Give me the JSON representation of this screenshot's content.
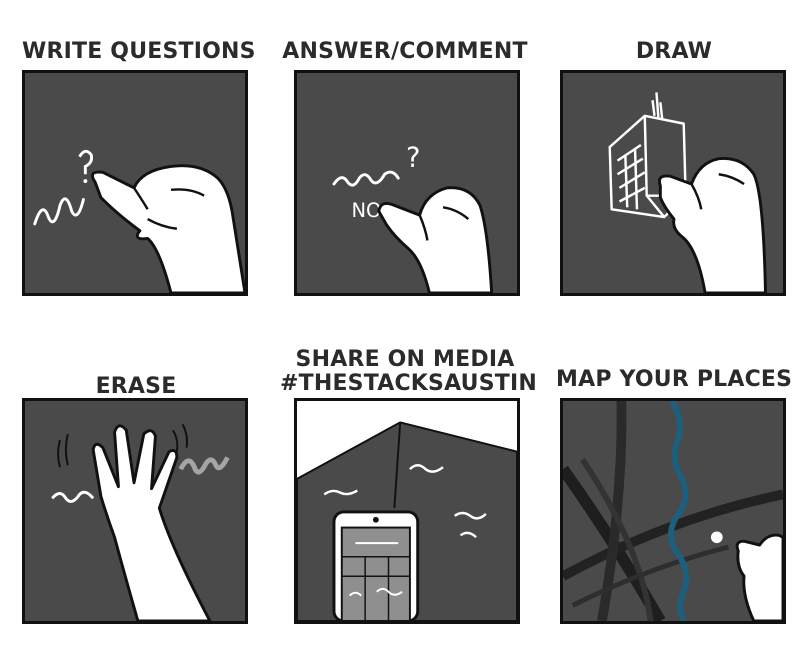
{
  "panels": [
    {
      "id": "write-questions",
      "title": "WRITE QUESTIONS"
    },
    {
      "id": "answer-comment",
      "title": "ANSWER/COMMENT",
      "board_text": [
        "?",
        "NO"
      ]
    },
    {
      "id": "draw",
      "title": "DRAW"
    },
    {
      "id": "erase",
      "title": "ERASE"
    },
    {
      "id": "share-on-media",
      "title_lines": [
        "SHARE ON MEDIA",
        "#THESTACKSAUSTIN"
      ]
    },
    {
      "id": "map-your-places",
      "title": "MAP YOUR PLACES"
    }
  ],
  "colors": {
    "board": "#4a4a4a",
    "ink": "#111111",
    "chalk": "#ffffff",
    "river": "#1d5f7e"
  }
}
